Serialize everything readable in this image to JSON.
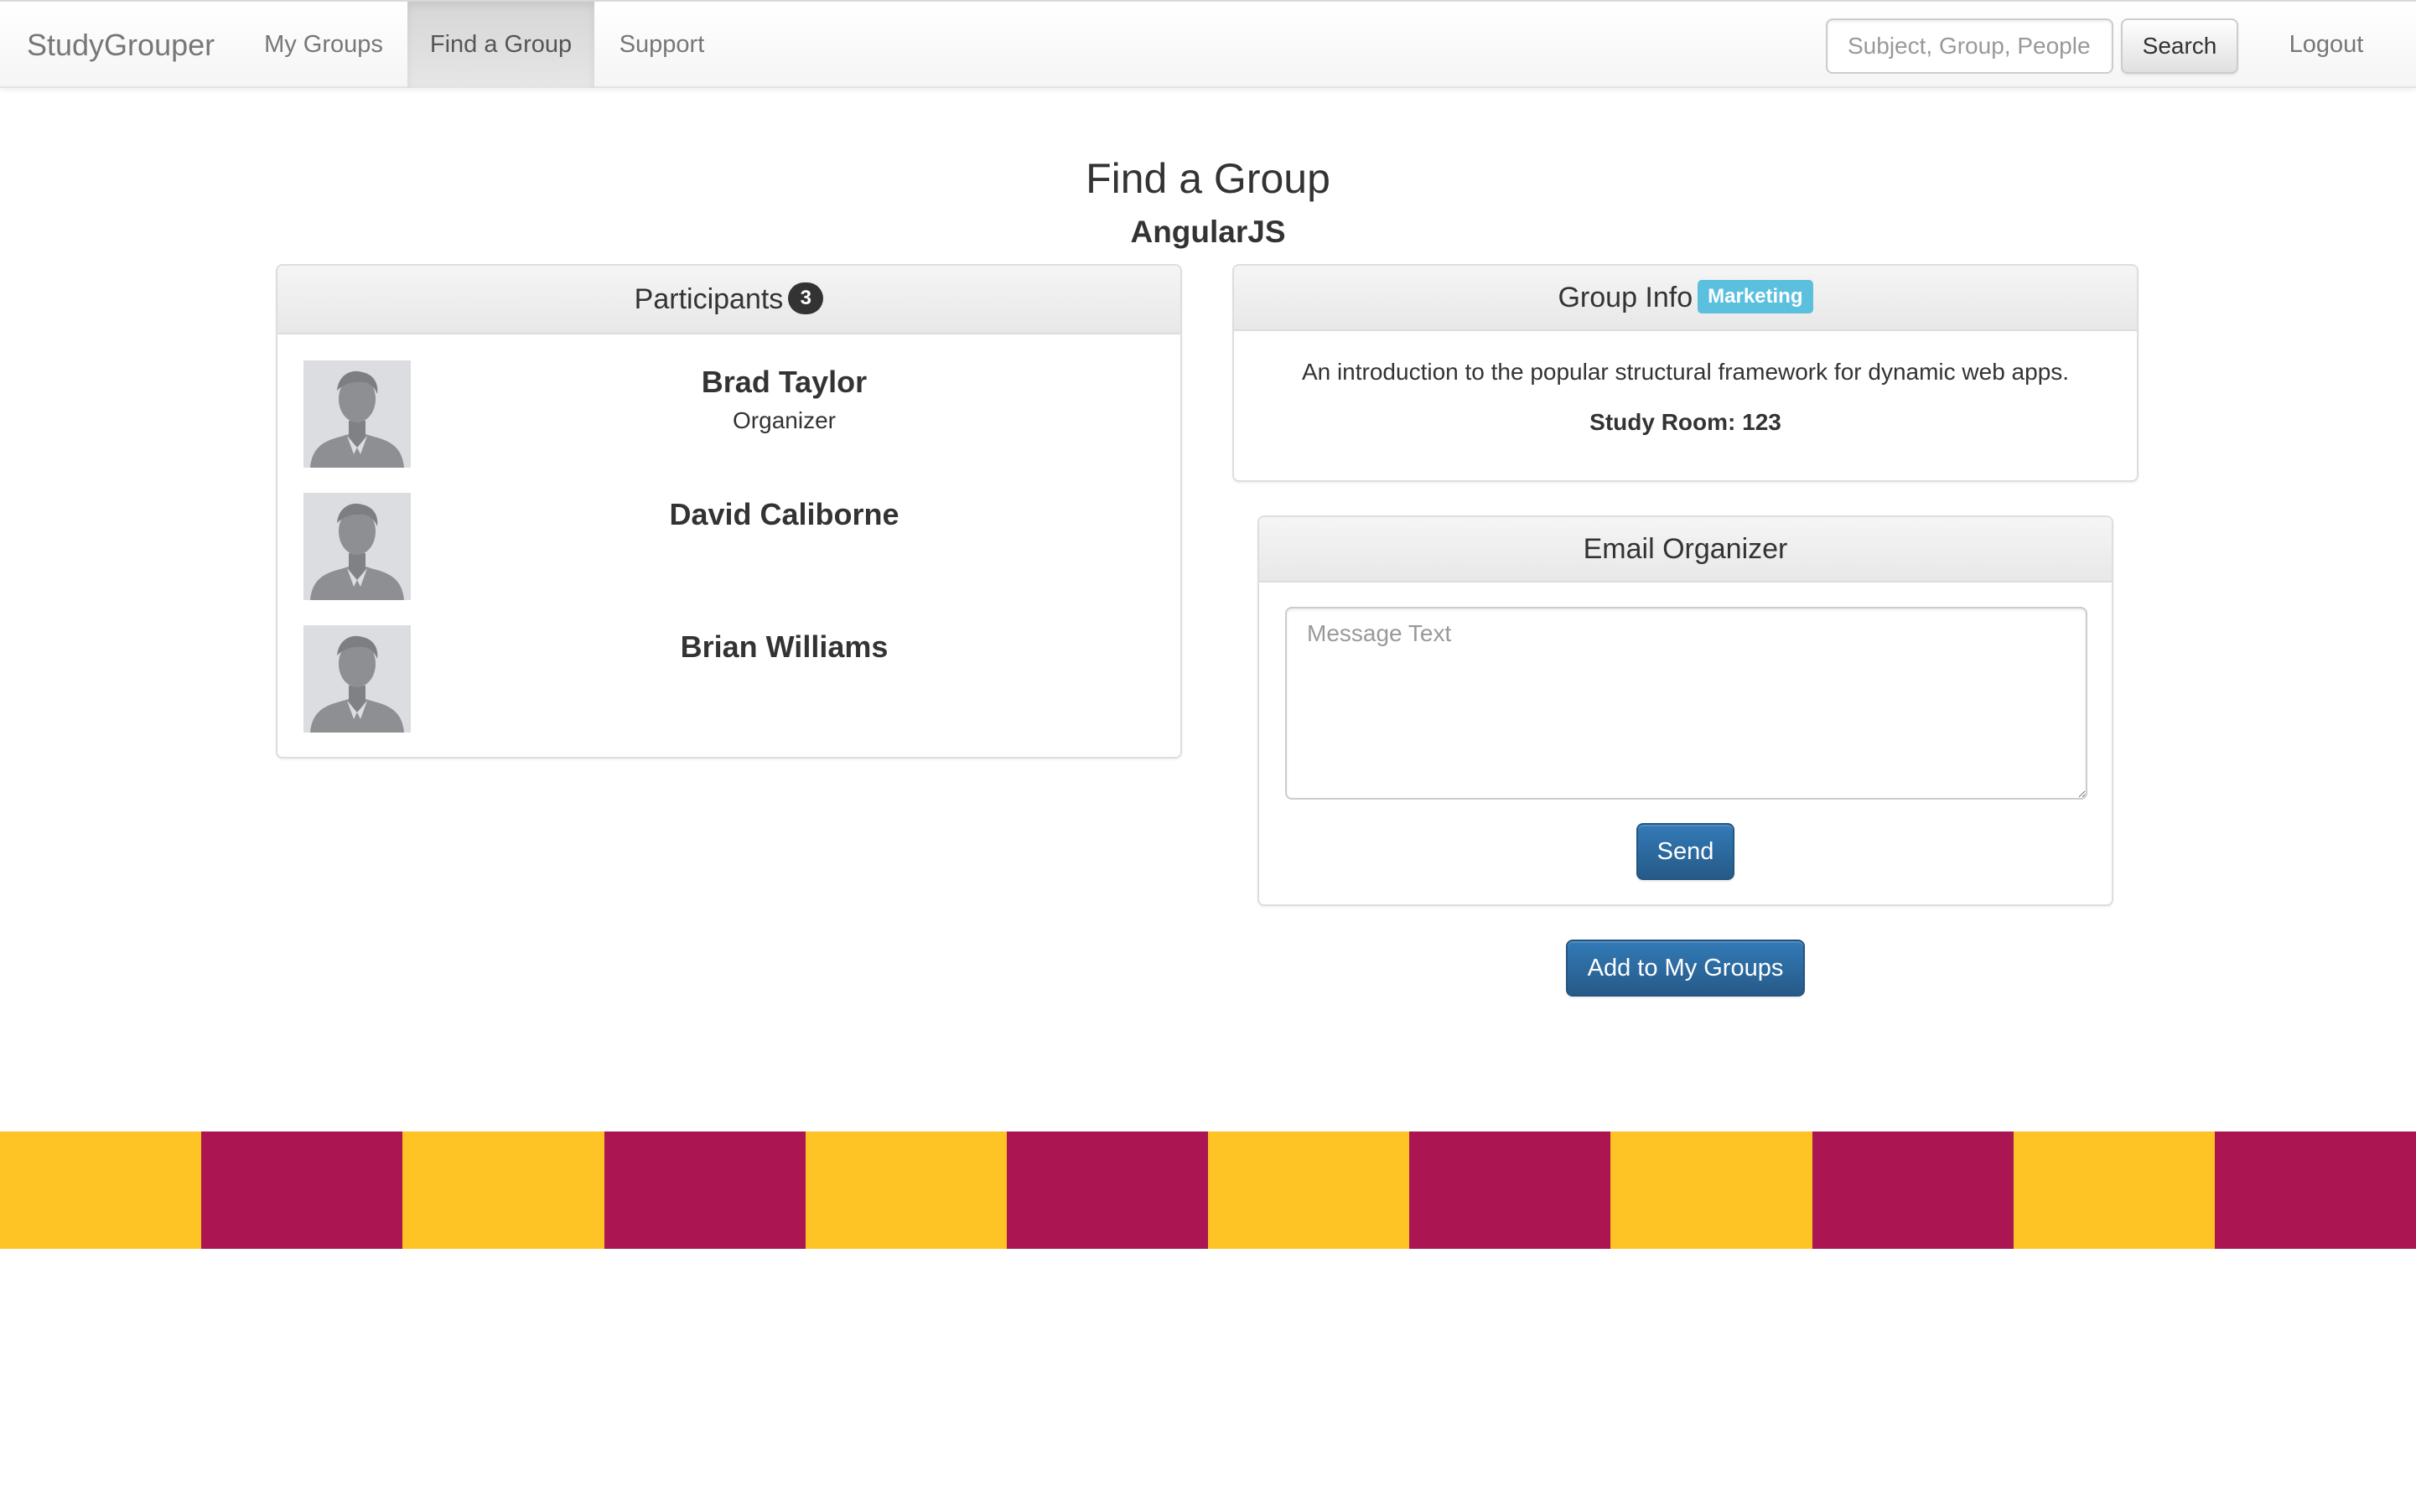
{
  "navbar": {
    "brand": "StudyGrouper",
    "items": [
      {
        "label": "My Groups",
        "active": false
      },
      {
        "label": "Find a Group",
        "active": true
      },
      {
        "label": "Support",
        "active": false
      }
    ],
    "search": {
      "placeholder": "Subject, Group, People",
      "value": "",
      "button_label": "Search"
    },
    "logout_label": "Logout"
  },
  "page": {
    "title": "Find a Group",
    "group_name": "AngularJS"
  },
  "participants": {
    "heading": "Participants",
    "count": "3",
    "items": [
      {
        "name": "Brad Taylor",
        "role": "Organizer",
        "avatar_icon": "user-silhouette-icon"
      },
      {
        "name": "David Caliborne",
        "role": "",
        "avatar_icon": "user-silhouette-icon"
      },
      {
        "name": "Brian Williams",
        "role": "",
        "avatar_icon": "user-silhouette-icon"
      }
    ]
  },
  "group_info": {
    "heading": "Group Info",
    "category_label": "Marketing",
    "description": "An introduction to the popular structural framework for dynamic web apps.",
    "study_room": "Study Room: 123"
  },
  "email_organizer": {
    "heading": "Email Organizer",
    "message_placeholder": "Message Text",
    "message_value": "",
    "send_label": "Send"
  },
  "actions": {
    "add_to_groups_label": "Add to My Groups"
  },
  "colors": {
    "primary": "#337ab7",
    "badge_info": "#5bc0de",
    "stripe_gold": "#fec325",
    "stripe_maroon": "#ab1552"
  },
  "footer_stripe": [
    "gold",
    "maroon",
    "gold",
    "maroon",
    "gold",
    "maroon",
    "gold",
    "maroon",
    "gold",
    "maroon",
    "gold",
    "maroon"
  ]
}
